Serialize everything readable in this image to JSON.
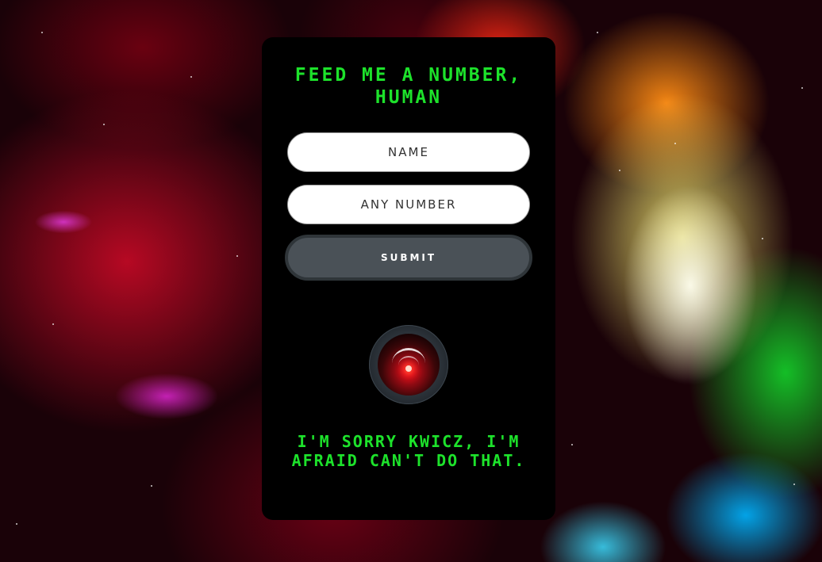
{
  "app": {
    "title": "Feed me a number, Human"
  },
  "form": {
    "name_placeholder": "NAME",
    "number_placeholder": "ANY NUMBER",
    "submit_label": "SUBMIT"
  },
  "hal": {
    "icon": "hal-9000-eye-icon"
  },
  "response": {
    "message": "I'm sorry Kwicz, I'm afraid can't do that."
  },
  "colors": {
    "terminal_green": "#1de22b",
    "card_background": "#000000",
    "button_gray": "#4a5157"
  }
}
